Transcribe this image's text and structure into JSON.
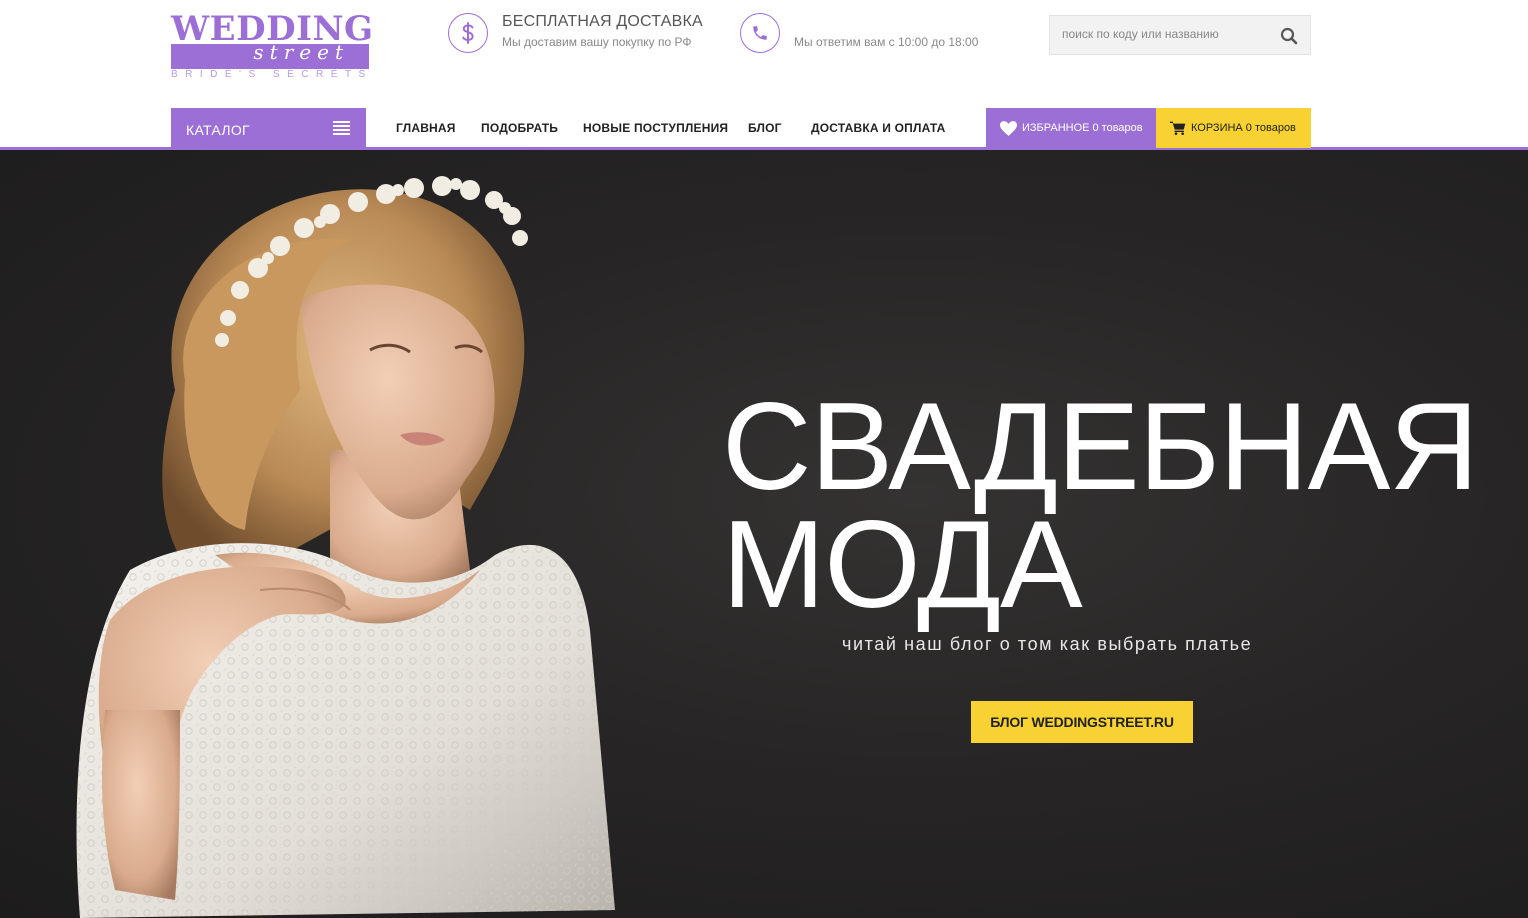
{
  "logo": {
    "word": "WEDDING",
    "street": "street",
    "tagline": "BRIDE'S SECRETS"
  },
  "delivery": {
    "icon": "dollar-icon",
    "title": "БЕСПЛАТНАЯ ДОСТАВКА",
    "subtitle": "Мы доставим вашу покупку по РФ"
  },
  "support": {
    "icon": "phone-icon",
    "subtitle": "Мы ответим вам с 10:00 до 18:00"
  },
  "search": {
    "placeholder": "поиск по коду или названию",
    "icon": "search-icon"
  },
  "catalog": {
    "label": "КАТАЛОГ",
    "icon": "list-icon"
  },
  "menu": [
    {
      "label": "ГЛАВНАЯ"
    },
    {
      "label": "ПОДОБРАТЬ"
    },
    {
      "label": "НОВЫЕ ПОСТУПЛЕНИЯ"
    },
    {
      "label": "БЛОГ"
    },
    {
      "label": "ДОСТАВКА И ОПЛАТА"
    }
  ],
  "favorites": {
    "icon": "heart-icon",
    "label": "ИЗБРАННОЕ",
    "count": "0 товаров"
  },
  "cart": {
    "icon": "cart-icon",
    "label": "КОРЗИНА",
    "count": "0 товаров"
  },
  "hero": {
    "title_line1": "СВАДЕБНАЯ",
    "title_line2": "МОДА",
    "subtitle": "читай наш блог о том как выбрать платье",
    "button": "БЛОГ WEDDINGSTREET.RU"
  },
  "colors": {
    "accent": "#9c6fd6",
    "button": "#f8d232",
    "hero_bg": "#272525"
  }
}
